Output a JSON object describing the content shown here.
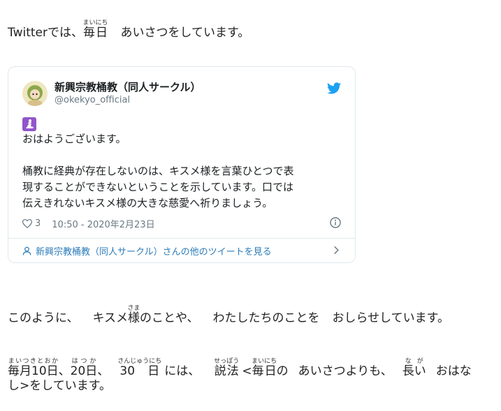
{
  "intro": {
    "text_a": "Twitterでは、",
    "w1_base": "毎日",
    "w1_ruby": "まいにち",
    "text_b": "あいさつをしています。"
  },
  "tweet": {
    "display_name": "新興宗教桶教（同人サークル）",
    "handle": "@okekyo_official",
    "emoji": "🛐",
    "line1": "おはようございます。",
    "line2": "桶教に経典が存在しないのは、キスメ様を言葉ひとつで表",
    "line3": "現することができないということを示しています。口では",
    "line4": "伝えきれないキスメ様の大きな慈愛へ祈りましょう。",
    "likes": "3",
    "timestamp": "10:50 - 2020年2月23日",
    "more_link": "新興宗教桶教（同人サークル）さんの他のツイートを見る",
    "accent_color": "#1da1f2"
  },
  "para2": {
    "text_a": "このように、",
    "name_pre": "キスメ",
    "w_base": "様",
    "w_ruby": "さま",
    "text_b": "のことや、",
    "text_c": "わたしたちのことを",
    "text_d": "おしらせしています。"
  },
  "para3": {
    "r1_base": "毎月10日",
    "r1_ruby": "まいつきとおか",
    "comma1": "、",
    "r2_base": "20日",
    "r2_ruby": "はつか",
    "comma2": "、",
    "r3_base": "30",
    "r3_ruby": "さんじゅうにち",
    "r3_tail": "日",
    "text_a": "には、",
    "r4_base": "説法",
    "r4_ruby": "せっぽう",
    "text_b": "<",
    "r5_base": "毎日",
    "r5_ruby": "まいにち",
    "text_c": "の",
    "text_d": "あいさつよりも、",
    "r6_base": "長い",
    "r6_ruby": "なが",
    "text_e": "おはな",
    "line2": "し>をしています。"
  }
}
